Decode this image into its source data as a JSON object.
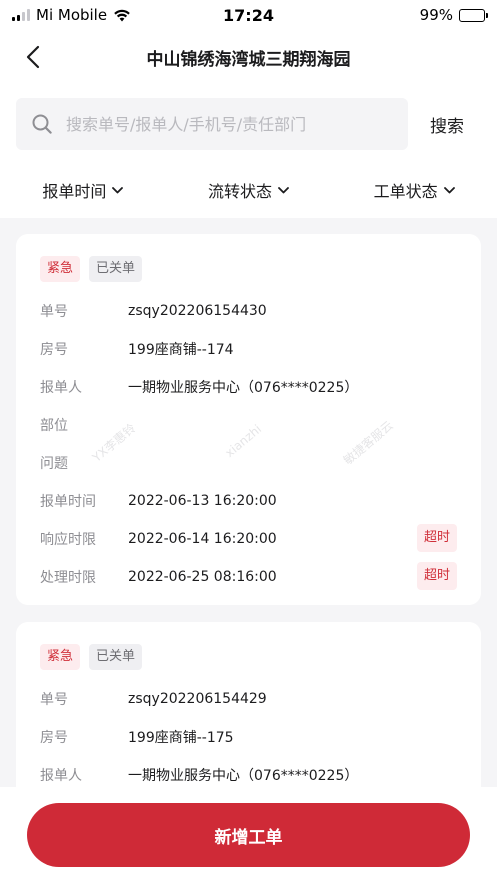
{
  "status_bar": {
    "carrier": "Mi Mobile",
    "time": "17:24",
    "battery_text": "99%",
    "battery_level": 0.99
  },
  "nav": {
    "title": "中山锦绣海湾城三期翔海园"
  },
  "search": {
    "placeholder": "搜索单号/报单人/手机号/责任部门",
    "button_label": "搜索"
  },
  "filters": [
    "报单时间",
    "流转状态",
    "工单状态"
  ],
  "field_labels": {
    "order_no": "单号",
    "room": "房号",
    "reporter": "报单人",
    "location": "部位",
    "problem": "问题",
    "report_time": "报单时间",
    "response_limit": "响应时限",
    "handle_limit": "处理时限"
  },
  "overdue_label": "超时",
  "watermarks": [
    "YX李惠铃",
    "xianzhi",
    "敏捷客服云"
  ],
  "orders": [
    {
      "tags": [
        "紧急",
        "已关单"
      ],
      "order_no": "zsqy202206154430",
      "room": "199座商铺--174",
      "reporter": "一期物业服务中心（076****0225）",
      "location": "",
      "problem": "",
      "report_time": "2022-06-13 16:20:00",
      "response_limit": "2022-06-14 16:20:00",
      "handle_limit": "2022-06-25 08:16:00"
    },
    {
      "tags": [
        "紧急",
        "已关单"
      ],
      "order_no": "zsqy202206154429",
      "room": "199座商铺--175",
      "reporter": "一期物业服务中心（076****0225）"
    }
  ],
  "bottom": {
    "add_button_label": "新增工单"
  },
  "colors": {
    "accent": "#cf2a37",
    "urgent_bg": "#fdecee",
    "closed_bg": "#efeff2"
  }
}
